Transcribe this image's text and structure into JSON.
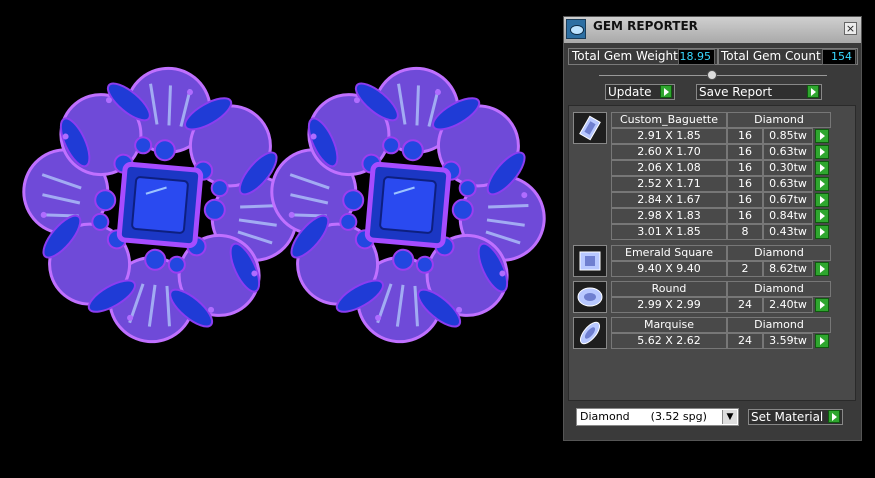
{
  "panel": {
    "title": "GEM REPORTER",
    "close_label": "×",
    "total_weight_label": "Total Gem Weight",
    "total_weight_value": "18.95",
    "total_count_label": "Total Gem Count",
    "total_count_value": "154",
    "update_label": "Update",
    "save_report_label": "Save Report",
    "set_material_label": "Set Material",
    "material_select": "Diamond      (3.52 spg)"
  },
  "groups": [
    {
      "icon": "baguette-cut-icon",
      "cut": "Custom_Baguette",
      "material": "Diamond",
      "rows": [
        {
          "size": "2.91 X 1.85",
          "count": "16",
          "weight": "0.85tw"
        },
        {
          "size": "2.60 X 1.70",
          "count": "16",
          "weight": "0.63tw"
        },
        {
          "size": "2.06 X 1.08",
          "count": "16",
          "weight": "0.30tw"
        },
        {
          "size": "2.52 X 1.71",
          "count": "16",
          "weight": "0.63tw"
        },
        {
          "size": "2.84 X 1.67",
          "count": "16",
          "weight": "0.67tw"
        },
        {
          "size": "2.98 X 1.83",
          "count": "16",
          "weight": "0.84tw"
        },
        {
          "size": "3.01 X 1.85",
          "count": "8",
          "weight": "0.43tw"
        }
      ]
    },
    {
      "icon": "emerald-square-cut-icon",
      "cut": "Emerald Square",
      "material": "Diamond",
      "rows": [
        {
          "size": "9.40 X 9.40",
          "count": "2",
          "weight": "8.62tw"
        }
      ]
    },
    {
      "icon": "round-cut-icon",
      "cut": "Round",
      "material": "Diamond",
      "rows": [
        {
          "size": "2.99 X 2.99",
          "count": "24",
          "weight": "2.40tw"
        }
      ]
    },
    {
      "icon": "marquise-cut-icon",
      "cut": "Marquise",
      "material": "Diamond",
      "rows": [
        {
          "size": "5.62 X 2.62",
          "count": "24",
          "weight": "3.59tw"
        }
      ]
    }
  ],
  "colors": {
    "value_text": "#39d8ff",
    "button_green": "#2fa62f",
    "gem_blue": "#1f3bd6",
    "metal_purple": "#9b3df0"
  }
}
